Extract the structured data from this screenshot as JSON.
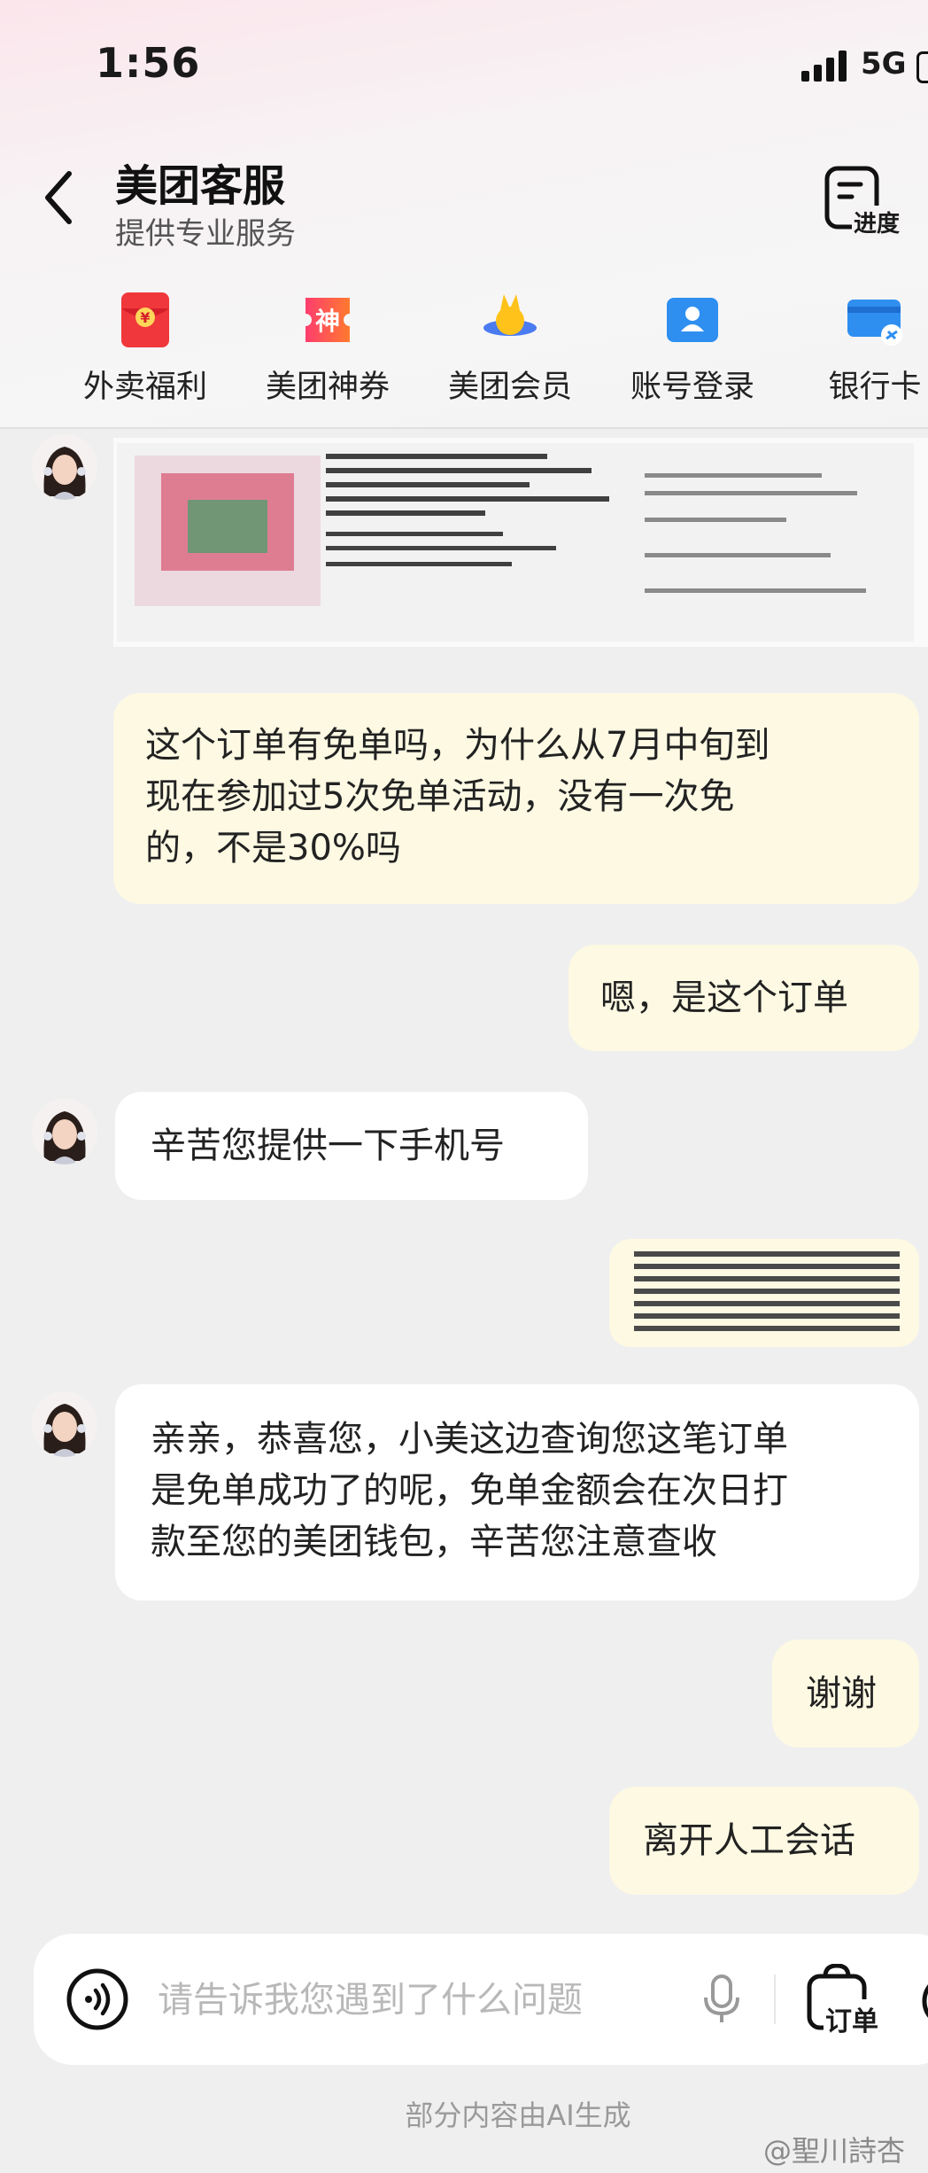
{
  "status_bar": {
    "time": "1:56",
    "network": "5G"
  },
  "header": {
    "title": "美团客服",
    "subtitle": "提供专业服务",
    "progress_label": "进度"
  },
  "quick_bar": {
    "items": [
      {
        "label": "外卖福利",
        "icon": "red-envelope-icon"
      },
      {
        "label": "美团神券",
        "icon": "coupon-icon",
        "glyph": "神"
      },
      {
        "label": "美团会员",
        "icon": "member-icon"
      },
      {
        "label": "账号登录",
        "icon": "account-icon"
      },
      {
        "label": "银行卡",
        "icon": "bank-card-icon"
      }
    ]
  },
  "messages": [
    {
      "from": "agent",
      "type": "image"
    },
    {
      "from": "user",
      "type": "text",
      "lines": [
        "这个订单有免单吗，为什么从7月中旬到",
        "现在参加过5次免单活动，没有一次免",
        "的，不是30%吗"
      ]
    },
    {
      "from": "user",
      "type": "text",
      "lines": [
        "嗯，是这个订单"
      ]
    },
    {
      "from": "agent",
      "type": "text",
      "lines": [
        "辛苦您提供一下手机号"
      ]
    },
    {
      "from": "user",
      "type": "image"
    },
    {
      "from": "agent",
      "type": "text",
      "lines": [
        "亲亲，恭喜您，小美这边查询您这笔订单",
        "是免单成功了的呢，免单金额会在次日打",
        "款至您的美团钱包，辛苦您注意查收"
      ]
    },
    {
      "from": "user",
      "type": "text",
      "lines": [
        "谢谢"
      ]
    },
    {
      "from": "user",
      "type": "text",
      "lines": [
        "离开人工会话"
      ]
    }
  ],
  "input": {
    "placeholder": "请告诉我您遇到了什么问题",
    "value": "",
    "order_label": "订单"
  },
  "footer": {
    "disclaimer": "部分内容由AI生成",
    "watermark": "@聖川詩杏"
  },
  "colors": {
    "user_bubble": "#fdf9e3",
    "agent_bubble": "#ffffff",
    "brand": "#ffd100"
  }
}
